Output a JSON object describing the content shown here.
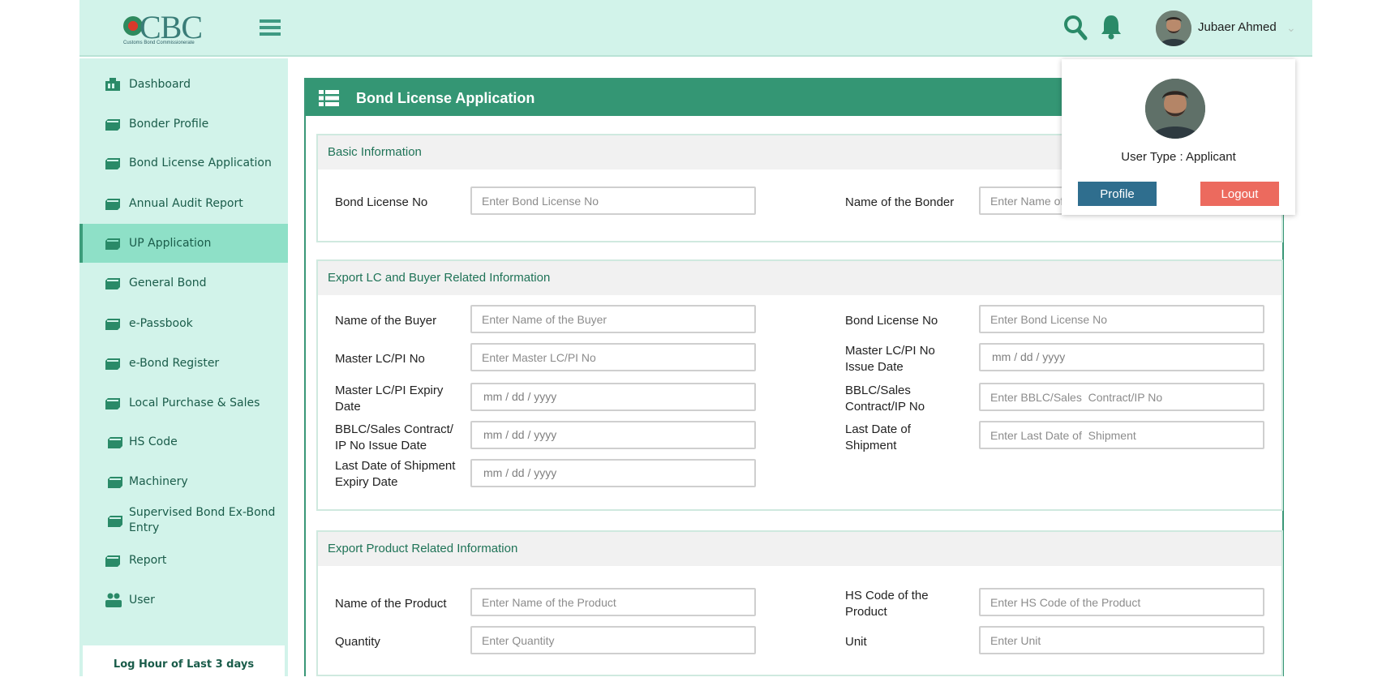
{
  "header": {
    "logo_text": "CBC",
    "logo_subtitle": "Customs Bond Commissionerate",
    "user_name": "Jubaer Ahmed"
  },
  "sidebar": {
    "items": [
      {
        "label": "Dashboard",
        "icon": "dashboard-icon"
      },
      {
        "label": "Bonder Profile",
        "icon": "folder-icon"
      },
      {
        "label": "Bond License Application",
        "icon": "folder-icon"
      },
      {
        "label": "Annual Audit Report",
        "icon": "folder-icon"
      },
      {
        "label": "UP Application",
        "icon": "folder-icon",
        "active": true
      },
      {
        "label": "General Bond",
        "icon": "folder-icon"
      },
      {
        "label": "e-Passbook",
        "icon": "folder-icon"
      },
      {
        "label": "e-Bond Register",
        "icon": "folder-icon"
      },
      {
        "label": "Local Purchase & Sales",
        "icon": "folder-icon"
      },
      {
        "label": "HS Code",
        "icon": "folder-icon"
      },
      {
        "label": "Machinery",
        "icon": "folder-icon"
      },
      {
        "label_line1": "Supervised Bond Ex-Bond",
        "label_line2": "Entry",
        "icon": "folder-icon"
      },
      {
        "label": "Report",
        "icon": "folder-icon"
      },
      {
        "label": "User",
        "icon": "users-icon"
      }
    ],
    "log_title": "Log Hour of Last 3 days"
  },
  "main": {
    "title": "Bond License Application",
    "sections": {
      "basic": {
        "title": "Basic Information",
        "fields": {
          "bond_license_no": {
            "label": "Bond License No",
            "placeholder": "Enter Bond License No"
          },
          "name_of_bonder": {
            "label": "Name of the Bonder",
            "placeholder": "Enter Name of the Bonder"
          }
        }
      },
      "export_lc": {
        "title": "Export LC and Buyer Related Information",
        "fields": {
          "buyer_name": {
            "label": "Name of the Buyer",
            "placeholder": "Enter Name of the Buyer"
          },
          "bond_license_no": {
            "label": "Bond License No",
            "placeholder": "Enter Bond License No"
          },
          "master_lc_no": {
            "label": "Master LC/PI No",
            "placeholder": "Enter Master LC/PI No"
          },
          "master_lc_issue": {
            "label_line1": "Master LC/PI No",
            "label_line2": "Issue Date",
            "value": "mm / dd / yyyy"
          },
          "master_lc_expiry": {
            "label_line1": "Master LC/PI Expiry",
            "label_line2": "Date",
            "value": "mm / dd / yyyy"
          },
          "bblc_no": {
            "label_line1": "BBLC/Sales",
            "label_line2": "Contract/IP No",
            "placeholder": "Enter BBLC/Sales  Contract/IP No"
          },
          "bblc_issue": {
            "label_line1": "BBLC/Sales Contract/",
            "label_line2": "IP No Issue Date",
            "value": "mm / dd / yyyy"
          },
          "last_shipment": {
            "label_line1": "Last Date of",
            "label_line2": "Shipment",
            "placeholder": "Enter Last Date of  Shipment"
          },
          "last_shipment_expiry": {
            "label_line1": "Last Date of Shipment",
            "label_line2": "Expiry Date",
            "value": "mm / dd / yyyy"
          }
        }
      },
      "export_product": {
        "title": "Export Product Related Information",
        "fields": {
          "product_name": {
            "label": "Name of the Product",
            "placeholder": "Enter Name of the Product"
          },
          "hs_code": {
            "label_line1": "HS Code of the",
            "label_line2": "Product",
            "placeholder": "Enter HS Code of the Product"
          },
          "quantity": {
            "label": "Quantity",
            "placeholder": "Enter Quantity"
          },
          "unit": {
            "label": "Unit",
            "placeholder": "Enter Unit"
          }
        }
      }
    }
  },
  "dropdown": {
    "user_type": "User Type :  Applicant",
    "profile_label": "Profile",
    "logout_label": "Logout"
  },
  "colors": {
    "primary": "#349674",
    "sidebar_bg": "#d2f3ea",
    "active_bg": "#8ee0c7",
    "profile_button": "#2f6e8e",
    "logout_button": "#ec6a5e"
  }
}
